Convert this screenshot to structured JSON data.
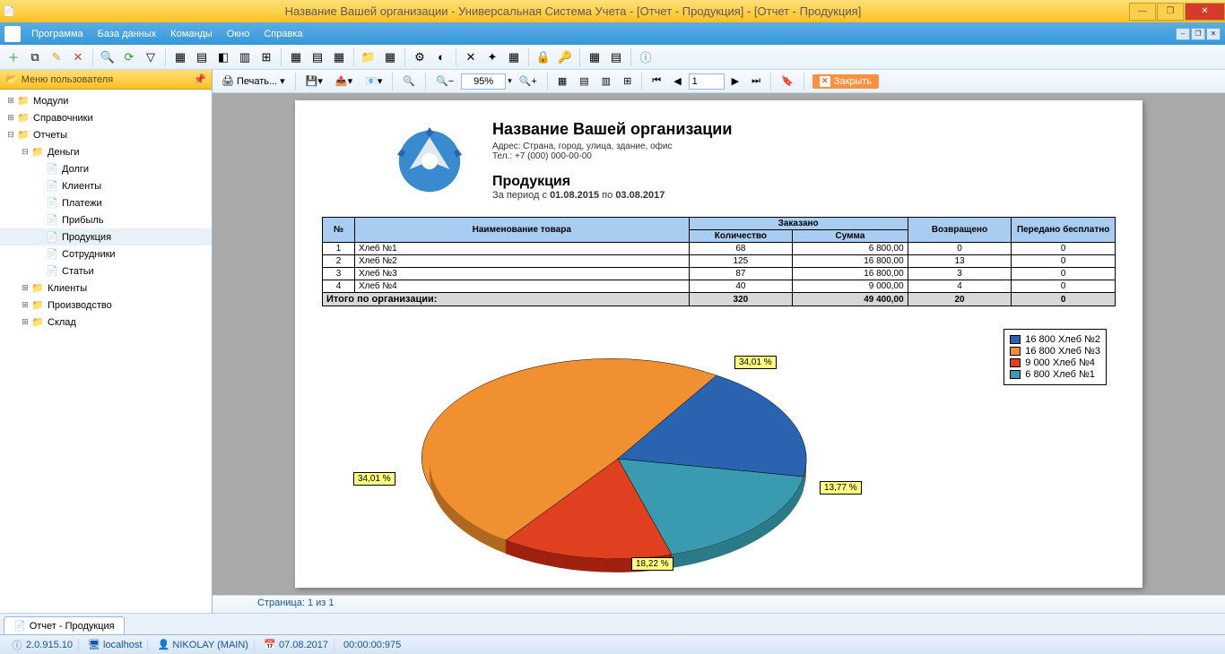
{
  "title": "Название Вашей организации - Универсальная Система Учета - [Отчет - Продукция] - [Отчет - Продукция]",
  "menu": {
    "items": [
      "Программа",
      "База данных",
      "Команды",
      "Окно",
      "Справка"
    ]
  },
  "sidebar": {
    "title": "Меню пользователя",
    "nodes": [
      {
        "label": "Модули",
        "depth": 0,
        "expand": "+",
        "folder": true
      },
      {
        "label": "Справочники",
        "depth": 0,
        "expand": "+",
        "folder": true
      },
      {
        "label": "Отчеты",
        "depth": 0,
        "expand": "−",
        "folder": true
      },
      {
        "label": "Деньги",
        "depth": 1,
        "expand": "−",
        "folder": true
      },
      {
        "label": "Долги",
        "depth": 2,
        "expand": "",
        "folder": false
      },
      {
        "label": "Клиенты",
        "depth": 2,
        "expand": "",
        "folder": false
      },
      {
        "label": "Платежи",
        "depth": 2,
        "expand": "",
        "folder": false
      },
      {
        "label": "Прибыль",
        "depth": 2,
        "expand": "",
        "folder": false
      },
      {
        "label": "Продукция",
        "depth": 2,
        "expand": "",
        "folder": false,
        "selected": true
      },
      {
        "label": "Сотрудники",
        "depth": 2,
        "expand": "",
        "folder": false
      },
      {
        "label": "Статьи",
        "depth": 2,
        "expand": "",
        "folder": false
      },
      {
        "label": "Клиенты",
        "depth": 1,
        "expand": "+",
        "folder": true
      },
      {
        "label": "Производство",
        "depth": 1,
        "expand": "+",
        "folder": true
      },
      {
        "label": "Склад",
        "depth": 1,
        "expand": "+",
        "folder": true
      }
    ]
  },
  "rtool": {
    "print": "Печать...",
    "zoom": "95%",
    "page": "1",
    "close": "Закрыть"
  },
  "report": {
    "org": "Название Вашей организации",
    "addr": "Адрес: Страна, город, улица, здание, офис",
    "tel": "Тел.: +7 (000) 000-00-00",
    "name": "Продукция",
    "period_prefix": "За период с ",
    "period_from": "01.08.2015",
    "period_mid": " по ",
    "period_to": "03.08.2017",
    "table": {
      "headers": {
        "num": "№",
        "name": "Наименование товара",
        "ordered": "Заказано",
        "qty": "Количество",
        "sum": "Сумма",
        "returned": "Возвращено",
        "free": "Передано бесплатно"
      },
      "rows": [
        {
          "n": "1",
          "name": "Хлеб №1",
          "qty": "68",
          "sum": "6 800,00",
          "ret": "0",
          "free": "0"
        },
        {
          "n": "2",
          "name": "Хлеб №2",
          "qty": "125",
          "sum": "16 800,00",
          "ret": "13",
          "free": "0"
        },
        {
          "n": "3",
          "name": "Хлеб №3",
          "qty": "87",
          "sum": "16 800,00",
          "ret": "3",
          "free": "0"
        },
        {
          "n": "4",
          "name": "Хлеб №4",
          "qty": "40",
          "sum": "9 000,00",
          "ret": "4",
          "free": "0"
        }
      ],
      "total": {
        "label": "Итого по организации:",
        "qty": "320",
        "sum": "49 400,00",
        "ret": "20",
        "free": "0"
      }
    }
  },
  "chart_data": {
    "type": "pie",
    "title": "",
    "series": [
      {
        "name": "16 800 Хлеб №2",
        "value": 16800,
        "percent": "34,01 %",
        "color": "#2a64b0"
      },
      {
        "name": "16 800 Хлеб №3",
        "value": 16800,
        "percent": "34,01 %",
        "color": "#f09030"
      },
      {
        "name": "9 000 Хлеб №4",
        "value": 9000,
        "percent": "18,22 %",
        "color": "#e04020"
      },
      {
        "name": "6 800 Хлеб №1",
        "value": 6800,
        "percent": "13,77 %",
        "color": "#3a9ab0"
      }
    ]
  },
  "page_status": "Страница: 1 из 1",
  "doctab": "Отчет - Продукция",
  "status": {
    "ver": "2.0.915.10",
    "host": "localhost",
    "user": "NIKOLAY (MAIN)",
    "date": "07.08.2017",
    "time": "00:00:00:975"
  }
}
